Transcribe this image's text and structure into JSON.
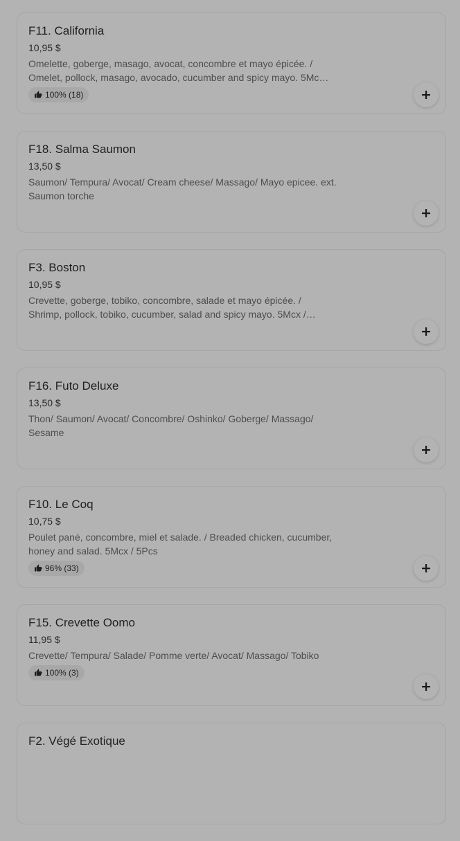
{
  "menu": {
    "items": [
      {
        "name": "F11. California",
        "price": "10,95 $",
        "description": "Omelette, goberge, masago, avocat, concombre et mayo épicée. / Omelet, pollock, masago, avocado, cucumber and spicy mayo. 5Mc…",
        "rating": "100% (18)"
      },
      {
        "name": "F18. Salma Saumon",
        "price": "13,50 $",
        "description": "Saumon/ Tempura/ Avocat/ Cream cheese/ Massago/ Mayo epicee. ext. Saumon torche",
        "rating": ""
      },
      {
        "name": "F3. Boston",
        "price": "10,95 $",
        "description": "Crevette, goberge, tobiko, concombre, salade et mayo épicée. / Shrimp, pollock, tobiko, cucumber, salad and spicy mayo. 5Mcx /…",
        "rating": ""
      },
      {
        "name": "F16. Futo Deluxe",
        "price": "13,50 $",
        "description": "Thon/ Saumon/ Avocat/ Concombre/ Oshinko/ Goberge/ Massago/ Sesame",
        "rating": ""
      },
      {
        "name": "F10. Le Coq",
        "price": "10,75 $",
        "description": "Poulet pané, concombre, miel et salade. / Breaded chicken, cucumber, honey and salad. 5Mcx / 5Pcs",
        "rating": "96% (33)"
      },
      {
        "name": "F15. Crevette Oomo",
        "price": "11,95 $",
        "description": "Crevette/ Tempura/ Salade/ Pomme verte/ Avocat/ Massago/ Tobiko",
        "rating": "100% (3)"
      },
      {
        "name": "F2. Végé Exotique",
        "price": "",
        "description": "",
        "rating": ""
      }
    ]
  },
  "icons": {
    "add": "plus-icon",
    "rating": "thumbs-up-icon"
  }
}
